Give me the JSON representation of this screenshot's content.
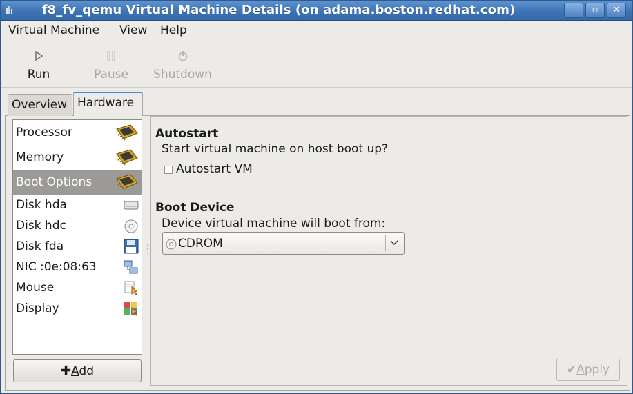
{
  "window": {
    "title": "f8_fv_qemu Virtual Machine Details (on adama.boston.redhat.com)",
    "minimize_glyph": "_",
    "maximize_glyph": "▫",
    "close_glyph": "✕"
  },
  "menubar": {
    "items": [
      {
        "prefix": "Virtual ",
        "mnemonic": "M",
        "suffix": "achine"
      },
      {
        "prefix": "",
        "mnemonic": "V",
        "suffix": "iew"
      },
      {
        "prefix": "",
        "mnemonic": "H",
        "suffix": "elp"
      }
    ]
  },
  "toolbar": {
    "run_label": "Run",
    "pause_label": "Pause",
    "shutdown_label": "Shutdown"
  },
  "tabs": {
    "overview": "Overview",
    "hardware": "Hardware",
    "active": "Hardware"
  },
  "hardware_list": {
    "items": [
      {
        "label": "Processor",
        "icon": "chip-icon"
      },
      {
        "label": "Memory",
        "icon": "chip-icon"
      },
      {
        "label": "Boot Options",
        "icon": "chip-icon",
        "selected": true
      },
      {
        "label": "Disk hda",
        "icon": "harddisk-icon"
      },
      {
        "label": "Disk hdc",
        "icon": "cdrom-icon"
      },
      {
        "label": "Disk fda",
        "icon": "floppy-icon"
      },
      {
        "label": "NIC :0e:08:63",
        "icon": "network-icon"
      },
      {
        "label": "Mouse",
        "icon": "mouse-icon"
      },
      {
        "label": "Display",
        "icon": "display-icon"
      }
    ],
    "add_prefix": "",
    "add_mnemonic": "A",
    "add_suffix": "dd"
  },
  "details": {
    "autostart_title": "Autostart",
    "autostart_desc": "Start virtual machine on host boot up?",
    "autostart_checkbox_label": "Autostart VM",
    "autostart_checked": false,
    "boot_device_title": "Boot Device",
    "boot_device_desc": "Device virtual machine will boot from:",
    "boot_device_value": "CDROM",
    "apply_mnemonic": "A",
    "apply_suffix": "pply"
  },
  "colors": {
    "titlebar": "#3e74b6",
    "selection": "#9c9a96",
    "disabled_text": "#aaa6a0"
  }
}
